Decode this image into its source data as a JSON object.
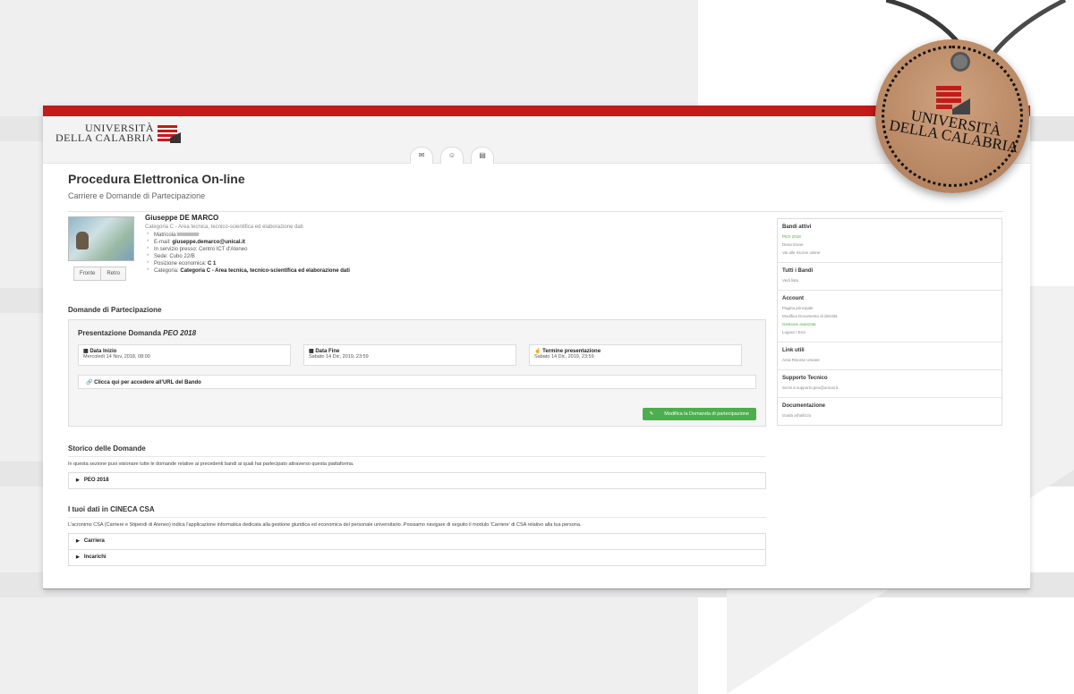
{
  "brand": {
    "logo_line1": "UNIVERSITÀ",
    "logo_line2": "DELLA CALABRIA",
    "tag_text": "UNIVERSITÀ DELLA CALABRIA",
    "red": "#c41a1a",
    "green": "#4cae4c"
  },
  "nav": {
    "items": [
      "e-mail-icon",
      "users-icon",
      "calendar-icon"
    ]
  },
  "page": {
    "title": "Procedura Elettronica On-line",
    "subtitle": "Carriere e Domande di Partecipazione"
  },
  "profile": {
    "name": "Giuseppe DE MARCO",
    "category": "Categoria C - Area tecnica, tecnico-scientifica ed elaborazione dati",
    "matricola_label": "Matricola:",
    "email_label": "E-mail:",
    "email": "giuseppe.demarco@unical.it",
    "servizio": "In servizio presso: Centro ICT d'Ateneo",
    "sede": "Sede: Cubo 22/B",
    "posizione_label": "Posizione economica:",
    "posizione": "C 1",
    "categoria_label": "Categoria:",
    "categoria": "Categoria C - Area tecnica, tecnico-scientifica ed elaborazione dati",
    "id_front": "Fronte",
    "id_back": "Retro"
  },
  "domande": {
    "section_title": "Domande di Partecipazione",
    "panel_title_prefix": "Presentazione Domanda ",
    "panel_title_name": "PEO 2018",
    "cards": [
      {
        "label": "Data Inizio",
        "value": "Mercoledì 14 Nov, 2018, 08:00",
        "icon": "calendar-icon"
      },
      {
        "label": "Data Fine",
        "value": "Sabato 14 Dic, 2019, 23:59",
        "icon": "calendar-icon"
      },
      {
        "label": "Termine presentazione",
        "value": "Sabato 14 Dic, 2019, 23:59",
        "icon": "hand-icon"
      }
    ],
    "url_link": "Clicca qui per accedere all'URL del Bando",
    "modify_button": "Modifica la Domanda di partecipazione"
  },
  "storico": {
    "title": "Storico delle Domande",
    "description": "In questa sezione puoi visionare tutte le domande relative ai precedenti bandi ai quali hai partecipato attraverso questa piattaforma.",
    "items": [
      "PEO 2018"
    ]
  },
  "cineca": {
    "title": "I tuoi dati in CINECA CSA",
    "description": "L'acronimo CSA (Carriere e Stipendi di Ateneo) indica l'applicazione informatica dedicata alla gestione giuridica ed economica del personale universitario. Possiamo navigare di seguito il modulo 'Carriere' di CSA relativo alla tua persona.",
    "items": [
      "Carriera",
      "Incarichi"
    ]
  },
  "sidebar": {
    "bandi_attivi": {
      "title": "Bandi attivi",
      "links": [
        "PEO 2018",
        "Descrizione",
        "Vai alle risorse online"
      ]
    },
    "tutti_bandi": {
      "title": "Tutti i Bandi",
      "links": [
        "Vedi lista"
      ]
    },
    "account": {
      "title": "Account",
      "links": [
        "Pagina principale",
        "Modifica Documento di identità",
        "Gestione avanzata",
        "Logout / Esci"
      ]
    },
    "link_utili": {
      "title": "Link utili",
      "links": [
        "Area Risorse Umane"
      ]
    },
    "supporto": {
      "title": "Supporto Tecnico",
      "links": [
        "Scrivi a supporto.peo@unical.it"
      ]
    },
    "documentazione": {
      "title": "Documentazione",
      "links": [
        "Guida all'utilizzo"
      ]
    }
  }
}
